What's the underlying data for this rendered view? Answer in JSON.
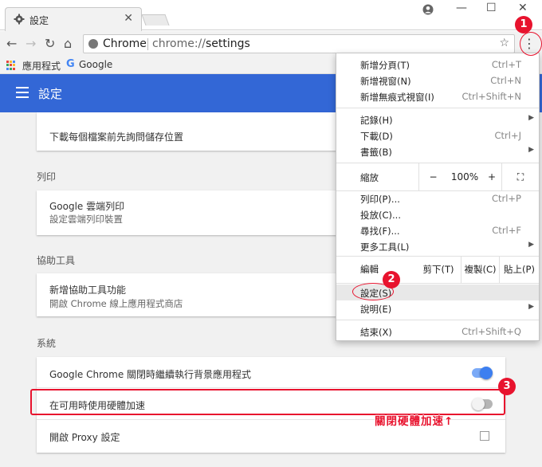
{
  "browser": {
    "tab_title": "設定",
    "tab_close": "✕",
    "window_controls": {
      "minimize": "—",
      "maximize": "☐",
      "close": "✕"
    },
    "omnibox": {
      "site_name": "Chrome",
      "url_prefix": "chrome://",
      "url_path": "settings"
    },
    "bookmarks": [
      {
        "label": "應用程式"
      },
      {
        "label": "Google"
      }
    ],
    "nav": {
      "back": "←",
      "forward": "→",
      "reload": "↻",
      "home": "⌂",
      "star": "☆",
      "menu": "⋮"
    }
  },
  "header": {
    "title": "設定"
  },
  "sections": {
    "download_row": "下載每個檔案前先詢問儲存位置",
    "print": {
      "label": "列印",
      "item_title": "Google 雲端列印",
      "item_sub": "設定雲端列印裝置"
    },
    "accessibility": {
      "label": "協助工具",
      "item_title": "新增協助工具功能",
      "item_sub": "開啟 Chrome 線上應用程式商店"
    },
    "system": {
      "label": "系統",
      "rows": [
        {
          "title": "Google Chrome 關閉時繼續執行背景應用程式",
          "toggle_on": true
        },
        {
          "title": "在可用時使用硬體加速",
          "toggle_on": false
        },
        {
          "title": "開啟 Proxy 設定"
        }
      ]
    }
  },
  "menu": {
    "group1": [
      {
        "label": "新增分頁(T)",
        "shortcut": "Ctrl+T"
      },
      {
        "label": "新增視窗(N)",
        "shortcut": "Ctrl+N"
      },
      {
        "label": "新增無痕式視窗(I)",
        "shortcut": "Ctrl+Shift+N"
      }
    ],
    "group2": [
      {
        "label": "記錄(H)",
        "shortcut": "",
        "submenu": true
      },
      {
        "label": "下載(D)",
        "shortcut": "Ctrl+J"
      },
      {
        "label": "書籤(B)",
        "shortcut": "",
        "submenu": true
      }
    ],
    "zoom": {
      "label": "縮放",
      "minus": "−",
      "value": "100%",
      "plus": "+",
      "fullscreen": "⛶"
    },
    "group3": [
      {
        "label": "列印(P)...",
        "shortcut": "Ctrl+P"
      },
      {
        "label": "投放(C)...",
        "shortcut": ""
      },
      {
        "label": "尋找(F)...",
        "shortcut": "Ctrl+F"
      },
      {
        "label": "更多工具(L)",
        "shortcut": "",
        "submenu": true
      }
    ],
    "edit": {
      "label": "編輯",
      "cut": "剪下(T)",
      "copy": "複製(C)",
      "paste": "貼上(P)"
    },
    "group4": [
      {
        "label": "設定(S)",
        "shortcut": ""
      },
      {
        "label": "說明(E)",
        "shortcut": "",
        "submenu": true
      }
    ],
    "exit": {
      "label": "結束(X)",
      "shortcut": "Ctrl+Shift+Q"
    }
  },
  "annotations": {
    "badge1": "1",
    "badge2": "2",
    "badge3": "3",
    "callout": "關閉硬體加速↑"
  },
  "colors": {
    "header": "#3367d6",
    "accent_red": "#e8132e",
    "toggle_on_track": "#7baaf7",
    "toggle_on_knob": "#3d7ff0",
    "toggle_off_track": "#b5b5b5",
    "toggle_off_knob": "#f3f3f3"
  },
  "icons": {
    "tab": "gear-icon",
    "account": "account-icon",
    "apps": "apps-grid-icon",
    "google": "google-g-icon",
    "menu": "hamburger-icon",
    "external": "external-link-icon"
  }
}
